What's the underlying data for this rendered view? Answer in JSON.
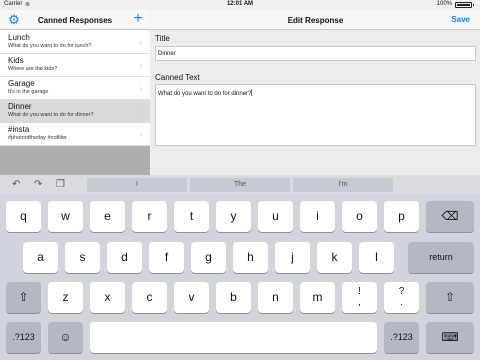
{
  "status": {
    "carrier": "Carrier",
    "wifi_icon": "wifi-icon",
    "time": "12:01 AM",
    "battery": "100%"
  },
  "master": {
    "title": "Canned Responses",
    "settings_icon": "gear-icon",
    "add_icon": "plus-icon",
    "items": [
      {
        "title": "Lunch",
        "subtitle": "What do you want to do for lunch?"
      },
      {
        "title": "Kids",
        "subtitle": "Where are the kids?"
      },
      {
        "title": "Garage",
        "subtitle": "It's in the garage"
      },
      {
        "title": "Dinner",
        "subtitle": "What do you want to do for dinner?"
      },
      {
        "title": "#insta",
        "subtitle": "#photooftheday #nofilter"
      }
    ]
  },
  "detail": {
    "title": "Edit Response",
    "save_label": "Save",
    "title_label": "Title",
    "title_value": "Dinner",
    "text_label": "Canned Text",
    "text_value": "What do you want to do for dinner?"
  },
  "keyboard": {
    "suggestions": [
      "I",
      "The",
      "I'm"
    ],
    "row1": [
      "q",
      "w",
      "e",
      "r",
      "t",
      "y",
      "u",
      "i",
      "o",
      "p"
    ],
    "row2": [
      "a",
      "s",
      "d",
      "f",
      "g",
      "h",
      "j",
      "k",
      "l"
    ],
    "row3": [
      "z",
      "x",
      "c",
      "v",
      "b",
      "n",
      "m"
    ],
    "punct1": {
      "top": "!",
      "bottom": ","
    },
    "punct2": {
      "top": "?",
      "bottom": "."
    },
    "return_label": "return",
    "numbers_label": ".?123",
    "numbers_label_right": ".?123"
  }
}
